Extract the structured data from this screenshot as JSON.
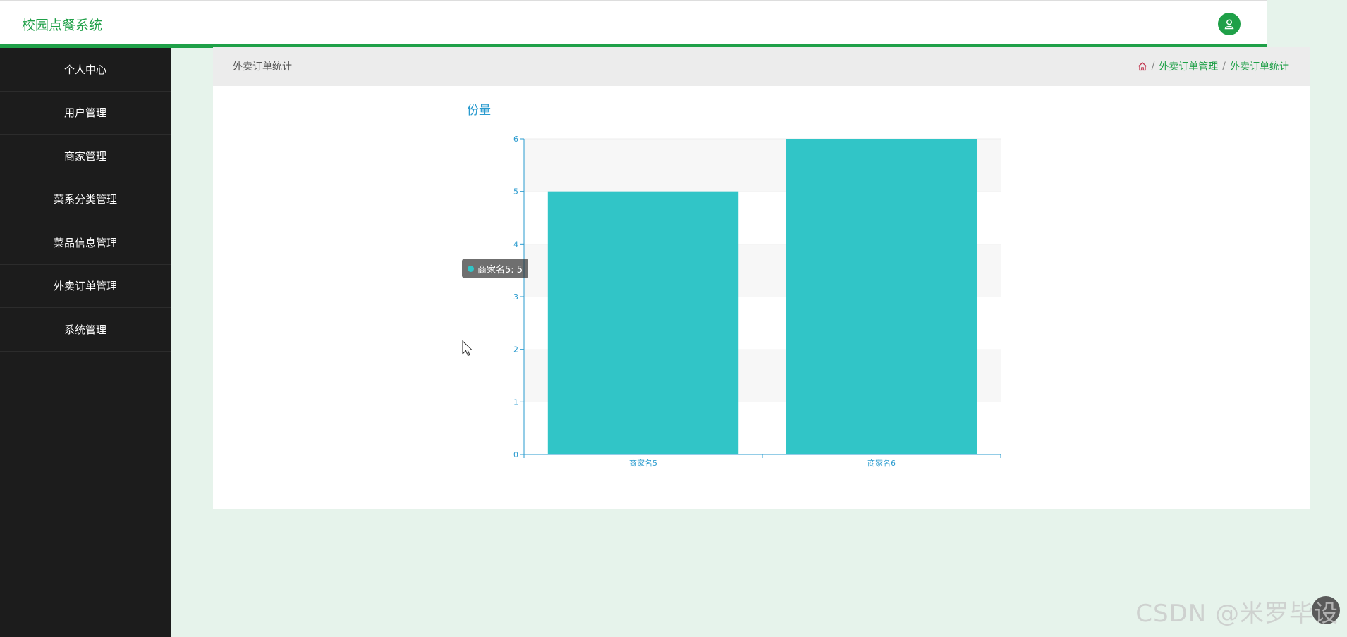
{
  "app": {
    "title": "校园点餐系统"
  },
  "sidebar": {
    "items": [
      {
        "label": "个人中心"
      },
      {
        "label": "用户管理"
      },
      {
        "label": "商家管理"
      },
      {
        "label": "菜系分类管理"
      },
      {
        "label": "菜品信息管理"
      },
      {
        "label": "外卖订单管理"
      },
      {
        "label": "系统管理"
      }
    ]
  },
  "page": {
    "title": "外卖订单统计",
    "breadcrumb": [
      "外卖订单管理",
      "外卖订单统计"
    ]
  },
  "chart_data": {
    "type": "bar",
    "title": "份量",
    "categories": [
      "商家名5",
      "商家名6"
    ],
    "values": [
      5,
      6
    ],
    "ylim": [
      0,
      6
    ],
    "yticks": [
      0,
      1,
      2,
      3,
      4,
      5,
      6
    ],
    "color": "#31c5c7",
    "grid": true,
    "tooltip": "商家名5: 5"
  },
  "watermark": "CSDN @米罗毕设",
  "colors": {
    "accent": "#1fa048",
    "sidebar": "#1c1c1c",
    "bar": "#31c5c7",
    "axis": "#2a9bcf"
  }
}
